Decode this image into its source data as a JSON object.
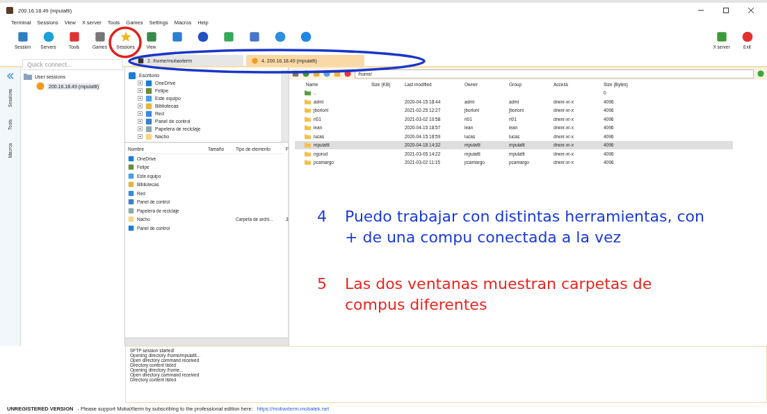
{
  "window": {
    "title": "200.16.18.49 (mpuiatti)"
  },
  "menu": [
    "Terminal",
    "Sessions",
    "View",
    "X server",
    "Tools",
    "Games",
    "Settings",
    "Macros",
    "Help"
  ],
  "toolbar": {
    "left": [
      "Session",
      "Servers",
      "Tools",
      "Games",
      "Sessions",
      "View"
    ],
    "right": [
      "X server",
      "Exit"
    ]
  },
  "tabs": [
    {
      "label": "2. /home/mobaxterm",
      "selected": false
    },
    {
      "label": "4. 200.16.18.49 (mpuiatti)",
      "selected": true
    }
  ],
  "side_tabs": [
    "Sessions",
    "Tools",
    "Macros"
  ],
  "quick_connect": {
    "placeholder": "Quick connect..."
  },
  "sessions": {
    "label": "User sessions",
    "children": [
      {
        "label": "200.16.18.49 (mpuiatti)",
        "selected": true
      }
    ]
  },
  "local_tree": {
    "label": "Escritorio",
    "children": [
      {
        "label": "OneDrive"
      },
      {
        "label": "Felipe"
      },
      {
        "label": "Este equipo"
      },
      {
        "label": "Bibliotecas"
      },
      {
        "label": "Red"
      },
      {
        "label": "Panel de control"
      },
      {
        "label": "Papelera de reciclaje"
      },
      {
        "label": "Nacho"
      }
    ]
  },
  "local_list": {
    "columns": [
      "Nombre",
      "Tamaño",
      "Tipo de elemento",
      "F"
    ],
    "rows": [
      {
        "name": "OneDrive",
        "type": ""
      },
      {
        "name": "Felipe",
        "type": ""
      },
      {
        "name": "Este equipo",
        "type": ""
      },
      {
        "name": "Bibliotecas",
        "type": ""
      },
      {
        "name": "Red",
        "type": ""
      },
      {
        "name": "Panel de control",
        "type": ""
      },
      {
        "name": "Papelera de reciclaje",
        "type": ""
      },
      {
        "name": "Nacho",
        "type": "Carpeta de archi...",
        "extra": "3"
      },
      {
        "name": "Panel de control",
        "type": ""
      }
    ]
  },
  "remote": {
    "path": "/home/",
    "columns": [
      "Name",
      "Size (KB)",
      "Last modified",
      "Owner",
      "Group",
      "Access",
      "Size (Bytes)"
    ],
    "rows": [
      {
        "cells": [
          "..",
          "",
          "",
          "",
          "",
          "",
          "0"
        ],
        "kind": "parent",
        "selected": false
      },
      {
        "cells": [
          "admi",
          "",
          "2020-04-15 18:44",
          "admi",
          "admi",
          "drwxr-xr-x",
          "4096"
        ],
        "kind": "folder",
        "selected": false
      },
      {
        "cells": [
          "jborioni",
          "",
          "2021-02-25 12:27",
          "jborioni",
          "jborioni",
          "drwxr-xr-x",
          "4096"
        ],
        "kind": "folder",
        "selected": false
      },
      {
        "cells": [
          "ri01",
          "",
          "2021-03-02 10:58",
          "ri01",
          "ri01",
          "drwxr-xr-x",
          "4096"
        ],
        "kind": "folder",
        "selected": false
      },
      {
        "cells": [
          "lean",
          "",
          "2020-04-15 18:57",
          "lean",
          "lean",
          "drwxr-xr-x",
          "4096"
        ],
        "kind": "folder",
        "selected": false
      },
      {
        "cells": [
          "lucas",
          "",
          "2020-04-15 18:59",
          "lucas",
          "lucas",
          "drwxr-xr-x",
          "4096"
        ],
        "kind": "folder",
        "selected": false
      },
      {
        "cells": [
          "mpuiatti",
          "",
          "2020-04-18 14:32",
          "mpuiatti",
          "mpuiatti",
          "drwxr-xr-x",
          "4096"
        ],
        "kind": "folder",
        "selected": true
      },
      {
        "cells": [
          "ngorod",
          "",
          "2021-03-05 14:22",
          "mpuiatti",
          "mpuiatti",
          "drwxr-xr-x",
          "4096"
        ],
        "kind": "folder",
        "selected": false
      },
      {
        "cells": [
          "pcamargo",
          "",
          "2021-03-02 11:15",
          "pcamargo",
          "pcamargo",
          "drwxr-xr-x",
          "4096"
        ],
        "kind": "folder",
        "selected": false
      }
    ]
  },
  "notes": [
    {
      "number": "4",
      "text": "Puedo trabajar con distintas herramientas, con + de una compu conectada a la vez",
      "color": "#1a3ad8"
    },
    {
      "number": "5",
      "text": "Las dos ventanas muestran carpetas de compus diferentes",
      "color": "#e8251f"
    }
  ],
  "log": [
    "SFTP session started!",
    "Opening directory /home/mpuiatti...",
    "Open directory command received",
    "Directory content listed",
    "Opening directory /home...",
    "Open directory command received",
    "Directory content listed"
  ],
  "status": {
    "label": "UNREGISTERED VERSION",
    "text": "-  Please support MobaXterm by subscribing to the professional edition here:",
    "link": "https://mobaxterm.mobatek.net"
  }
}
